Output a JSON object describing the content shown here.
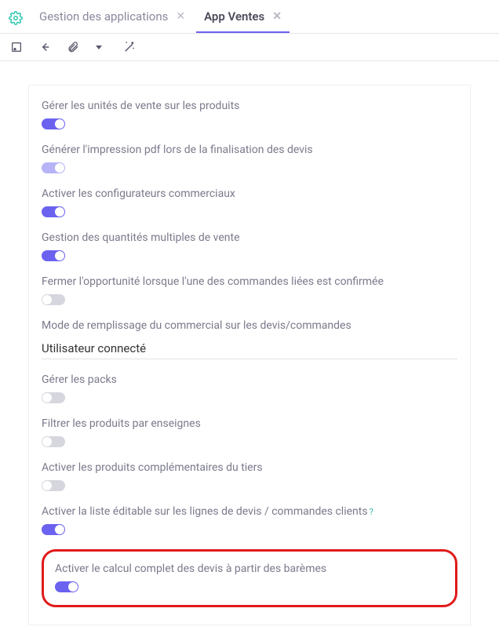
{
  "tabs": {
    "management": "Gestion des applications",
    "sales": "App Ventes"
  },
  "settings": {
    "manage_units": {
      "label": "Gérer les unités de vente sur les produits",
      "on": true
    },
    "pdf_quote": {
      "label": "Générer l'impression pdf lors de la finalisation des devis",
      "on": true,
      "disabled": true
    },
    "configurators": {
      "label": "Activer les configurateurs commerciaux",
      "on": true
    },
    "multi_qty": {
      "label": "Gestion des quantités multiples de vente",
      "on": true
    },
    "close_opp": {
      "label": "Fermer l'opportunité lorsque l'une des commandes liées est confirmée",
      "on": false
    },
    "salesperson_mode": {
      "label": "Mode de remplissage du commercial sur les devis/commandes",
      "value": "Utilisateur connecté"
    },
    "packs": {
      "label": "Gérer les packs",
      "on": false
    },
    "filter_brands": {
      "label": "Filtrer les produits par enseignes",
      "on": false
    },
    "compl_prod": {
      "label": "Activer les produits complémentaires du tiers",
      "on": false
    },
    "editable_list": {
      "label": "Activer la liste éditable sur les lignes de devis / commandes clients",
      "on": true
    },
    "full_calc": {
      "label": "Activer le calcul complet des devis à partir des barèmes",
      "on": true
    }
  }
}
